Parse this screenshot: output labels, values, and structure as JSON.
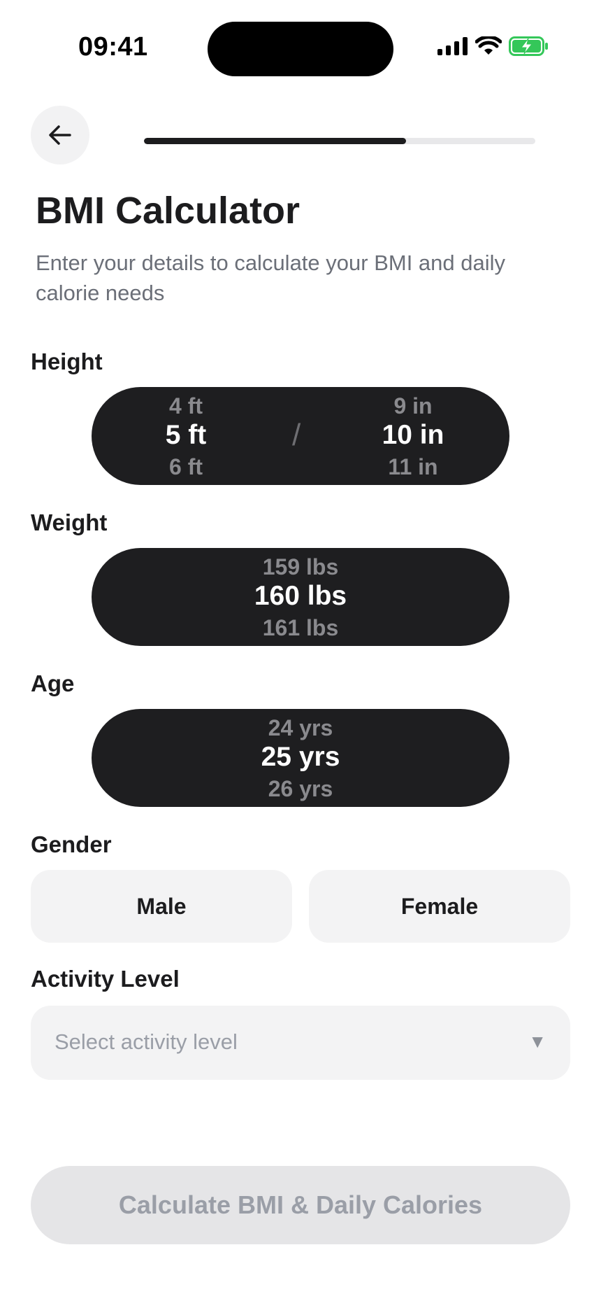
{
  "status_bar": {
    "time": "09:41"
  },
  "progress": {
    "fraction": 0.67
  },
  "header": {
    "title": "BMI Calculator",
    "subtitle": "Enter your details to calculate your BMI and daily calorie needs"
  },
  "height": {
    "label": "Height",
    "feet": {
      "prev": "4 ft",
      "selected": "5 ft",
      "next": "6 ft"
    },
    "separator": "/",
    "inches": {
      "prev": "9 in",
      "selected": "10 in",
      "next": "11 in"
    }
  },
  "weight": {
    "label": "Weight",
    "prev": "159 lbs",
    "selected": "160 lbs",
    "next": "161 lbs"
  },
  "age": {
    "label": "Age",
    "prev": "24 yrs",
    "selected": "25 yrs",
    "next": "26 yrs"
  },
  "gender": {
    "label": "Gender",
    "options": [
      "Male",
      "Female"
    ]
  },
  "activity": {
    "label": "Activity Level",
    "placeholder": "Select activity level",
    "arrow": "▼"
  },
  "cta": {
    "label": "Calculate BMI & Daily Calories"
  },
  "colors": {
    "picker_bg": "#1e1e20",
    "progress_fill": "#1c1c1e",
    "battery": "#34c759"
  },
  "icons": [
    "back-arrow-icon",
    "signal-icon",
    "wifi-icon",
    "battery-charging-icon",
    "chevron-down-icon"
  ]
}
